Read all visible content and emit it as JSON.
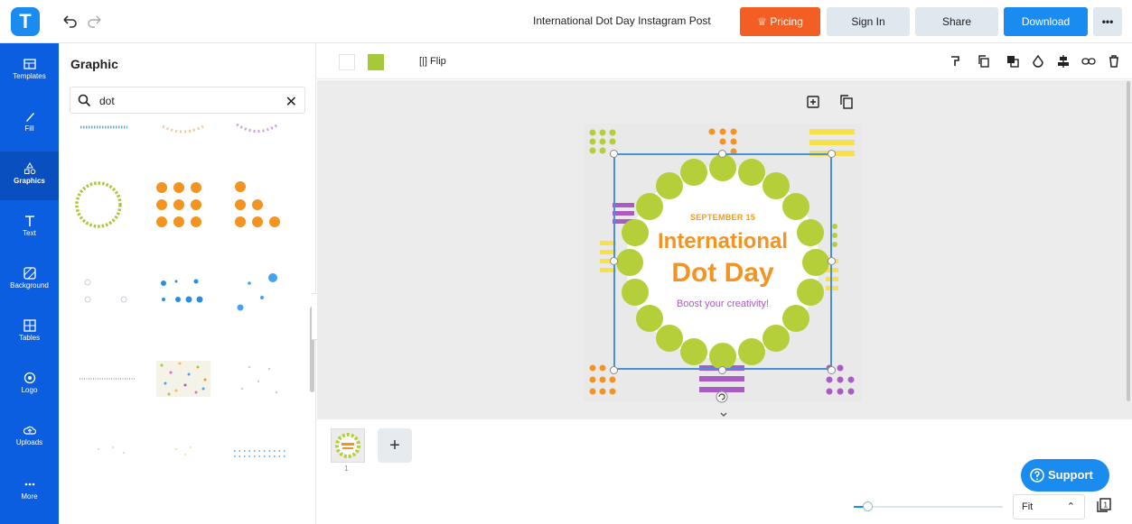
{
  "topbar": {
    "logo_letter": "T",
    "doc_title": "International Dot Day Instagram Post",
    "pricing_label": "Pricing",
    "signin_label": "Sign In",
    "share_label": "Share",
    "download_label": "Download",
    "more_label": "•••"
  },
  "rail": [
    {
      "label": "Templates",
      "icon": "templates-icon"
    },
    {
      "label": "Fill",
      "icon": "brush-icon"
    },
    {
      "label": "Graphics",
      "icon": "graphics-icon"
    },
    {
      "label": "Text",
      "icon": "text-icon"
    },
    {
      "label": "Background",
      "icon": "background-icon"
    },
    {
      "label": "Tables",
      "icon": "table-icon"
    },
    {
      "label": "Logo",
      "icon": "logo-icon"
    },
    {
      "label": "Uploads",
      "icon": "upload-icon"
    },
    {
      "label": "More",
      "icon": "more-icon"
    }
  ],
  "panel": {
    "title": "Graphic",
    "search_value": "dot"
  },
  "toolbar": {
    "flip_label": "Flip",
    "colors": [
      "#ffffff",
      "#a6c93a"
    ]
  },
  "canvas": {
    "date": "SEPTEMBER 15",
    "title_line1": "International",
    "title_line2": "Dot Day",
    "subtitle": "Boost your creativity!"
  },
  "pages": {
    "current_number": "1",
    "add_label": "+"
  },
  "support_label": "Support",
  "zoom": {
    "value": "Fit",
    "level": 0.05
  },
  "colors": {
    "accent": "#1a8cf0",
    "rail": "#0c5ee0",
    "pricing": "#f25e24",
    "green": "#b5cf3a",
    "orange": "#f39422",
    "purple": "#a85cc4",
    "yellow": "#f7e04a"
  }
}
